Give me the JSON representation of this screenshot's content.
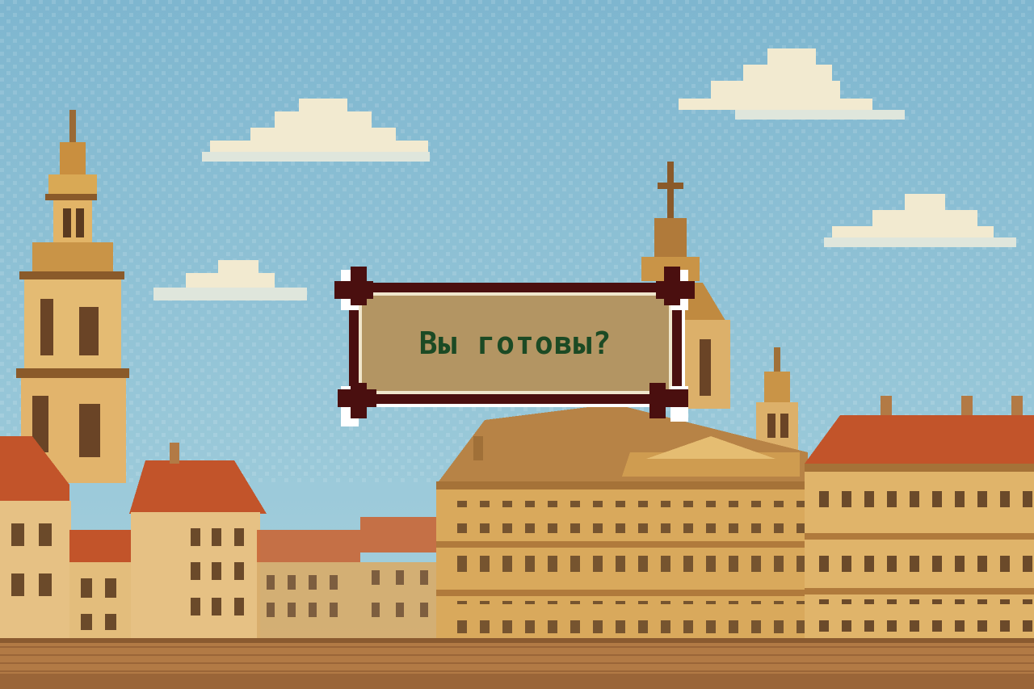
{
  "dialog": {
    "text": "Вы готовы?"
  },
  "colors": {
    "sky": "#8fc3d8",
    "dialog_frame": "#4a0f0f",
    "dialog_panel": "#b39563",
    "dialog_text": "#1c4a24",
    "roof": "#c2542a",
    "facade": "#e0b46a"
  }
}
